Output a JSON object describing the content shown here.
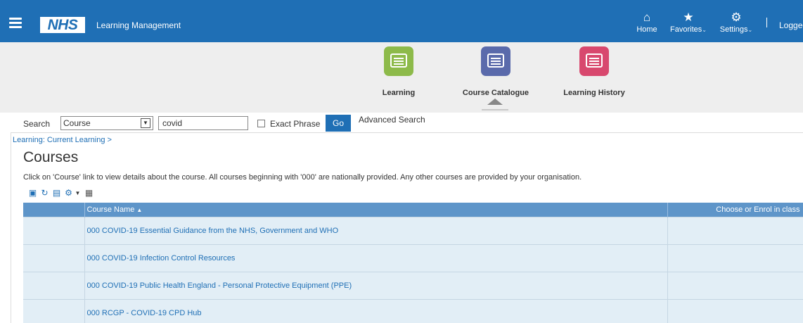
{
  "header": {
    "app_title": "Learning Management",
    "logo_text": "NHS",
    "home_label": "Home",
    "favorites_label": "Favorites",
    "settings_label": "Settings",
    "logged_in_text": "Logged",
    "accent_color": "#1f6fb5"
  },
  "springboard": {
    "tiles": [
      {
        "label": "Learning",
        "color": "#8dba4a"
      },
      {
        "label": "Course Catalogue",
        "color": "#5a6aab"
      },
      {
        "label": "Learning History",
        "color": "#d8486e"
      }
    ]
  },
  "search": {
    "label": "Search",
    "scope_value": "Course",
    "query_value": "covid",
    "exact_phrase_label": "Exact Phrase",
    "go_label": "Go",
    "advanced_label": "Advanced Search"
  },
  "page": {
    "breadcrumb": "Learning: Current Learning >",
    "title": "Courses",
    "instructions": "Click on 'Course' link to view details about the course. All courses beginning with '000' are nationally provided. Any other courses are provided by your organisation."
  },
  "table": {
    "columns": [
      "Course Name",
      "Choose or Enrol in class"
    ],
    "rows": [
      {
        "course_name": "000 COVID-19 Essential Guidance from the NHS, Government and WHO"
      },
      {
        "course_name": "000 COVID-19 Infection Control Resources"
      },
      {
        "course_name": "000 COVID-19 Public Health England - Personal Protective Equipment (PPE)"
      },
      {
        "course_name": "000 RCGP - COVID-19 CPD Hub"
      }
    ]
  }
}
